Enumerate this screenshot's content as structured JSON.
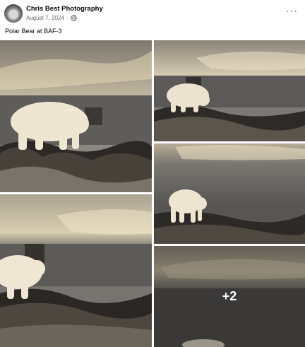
{
  "post": {
    "author": "Chris Best Photography",
    "date": "August 7, 2024",
    "separator": "·",
    "privacy_icon": "globe-icon",
    "caption": "Polar Bear at BAF-3",
    "menu_icon": "more-options-icon",
    "menu_label": "···"
  },
  "gallery": {
    "photo_count_visible": 5,
    "more_count_label": "+2"
  }
}
